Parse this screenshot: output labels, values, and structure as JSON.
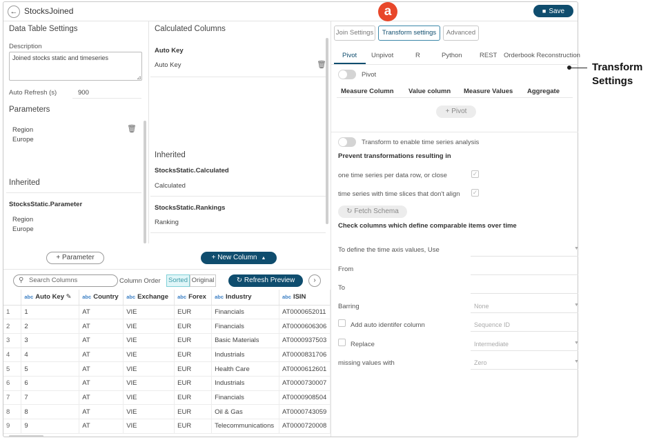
{
  "header": {
    "title": "StocksJoined",
    "back_icon": "arrow-left-icon",
    "save_label": "Save"
  },
  "data_table_settings": {
    "heading": "Data Table Settings",
    "description_label": "Description",
    "description_value": "Joined stocks static and timeseries",
    "auto_refresh_label": "Auto Refresh (s)",
    "auto_refresh_value": "900",
    "parameters_heading": "Parameters",
    "parameter_name": "Region",
    "parameter_value": "Europe",
    "inherited_heading": "Inherited",
    "inherited_source": "StocksStatic.Parameter",
    "inherited_param_name": "Region",
    "inherited_param_value": "Europe",
    "add_parameter_label": "Parameter"
  },
  "calculated_columns": {
    "heading": "Calculated Columns",
    "auto_key_title": "Auto Key",
    "auto_key_value": "Auto Key",
    "inherited_heading": "Inherited",
    "inherited_1_title": "StocksStatic.Calculated",
    "inherited_1_value": "Calculated",
    "inherited_2_title": "StocksStatic.Rankings",
    "inherited_2_value": "Ranking",
    "new_column_label": "New Column"
  },
  "transform_panel": {
    "tabs": [
      "Join Settings",
      "Transform settings",
      "Advanced"
    ],
    "active_tab": "Transform settings",
    "subtabs": [
      "Pivot",
      "Unpivot",
      "R",
      "Python",
      "REST",
      "Orderbook Reconstruction"
    ],
    "active_subtab": "Pivot",
    "pivot_toggle_label": "Pivot",
    "pivot_columns": [
      "Measure Column",
      "Value column",
      "Measure Values",
      "Aggregate"
    ],
    "add_pivot_label": "Pivot",
    "ts_toggle_label": "Transform to enable time series analysis",
    "prevent_heading": "Prevent transformations resulting in",
    "prevent_1": "one time series per data row, or close",
    "prevent_2": "time series with time slices that don't align",
    "fetch_schema_label": "Fetch Schema",
    "check_columns_heading": "Check columns which define comparable items over time",
    "time_axis_label": "To define the time axis values, Use",
    "from_label": "From",
    "to_label": "To",
    "barring_label": "Barring",
    "barring_value": "None",
    "auto_id_label": "Add auto identifer column",
    "auto_id_placeholder": "Sequence ID",
    "replace_label": "Replace",
    "replace_value": "Intermediate",
    "missing_label": "missing values with",
    "missing_value": "Zero"
  },
  "preview_toolbar": {
    "search_placeholder": "Search Columns",
    "column_order_label": "Column Order",
    "sorted_label": "Sorted",
    "original_label": "Original",
    "refresh_label": "Refresh Preview"
  },
  "table": {
    "type_tag": "abc",
    "columns": [
      "Auto Key",
      "Country",
      "Exchange",
      "Forex",
      "Industry",
      "ISIN"
    ],
    "rows": [
      [
        "1",
        "1",
        "AT",
        "VIE",
        "EUR",
        "Financials",
        "AT0000652011"
      ],
      [
        "2",
        "2",
        "AT",
        "VIE",
        "EUR",
        "Financials",
        "AT0000606306"
      ],
      [
        "3",
        "3",
        "AT",
        "VIE",
        "EUR",
        "Basic Materials",
        "AT0000937503"
      ],
      [
        "4",
        "4",
        "AT",
        "VIE",
        "EUR",
        "Industrials",
        "AT0000831706"
      ],
      [
        "5",
        "5",
        "AT",
        "VIE",
        "EUR",
        "Health Care",
        "AT0000612601"
      ],
      [
        "6",
        "6",
        "AT",
        "VIE",
        "EUR",
        "Industrials",
        "AT0000730007"
      ],
      [
        "7",
        "7",
        "AT",
        "VIE",
        "EUR",
        "Financials",
        "AT0000908504"
      ],
      [
        "8",
        "8",
        "AT",
        "VIE",
        "EUR",
        "Oil & Gas",
        "AT0000743059"
      ],
      [
        "9",
        "9",
        "AT",
        "VIE",
        "EUR",
        "Telecommunications",
        "AT0000720008"
      ]
    ]
  },
  "annotation": {
    "badge": "a",
    "callout_line1": "Transform",
    "callout_line2": "Settings"
  },
  "colors": {
    "accent": "#0f4d6e",
    "badge": "#e8472a"
  }
}
